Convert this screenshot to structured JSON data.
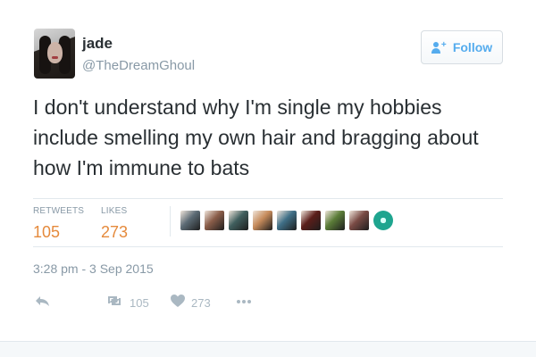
{
  "author": {
    "name": "jade",
    "handle": "@TheDreamGhoul"
  },
  "follow_button": {
    "label": "Follow"
  },
  "tweet": {
    "text": "I don't understand why I'm single my hobbies include smelling my own hair and bragging about how I'm immune to bats"
  },
  "stats": {
    "retweets_label": "RETWEETS",
    "retweets_count": "105",
    "likes_label": "LIKES",
    "likes_count": "273"
  },
  "liker_avatars": [
    {
      "name": "liker-avatar-1",
      "icon": "avatar",
      "color": "#5c6b75"
    },
    {
      "name": "liker-avatar-2",
      "icon": "avatar",
      "color": "#8a5d49"
    },
    {
      "name": "liker-avatar-3",
      "icon": "avatar",
      "color": "#405f5e"
    },
    {
      "name": "liker-avatar-4",
      "icon": "avatar",
      "color": "#c68b5b"
    },
    {
      "name": "liker-avatar-5",
      "icon": "avatar",
      "color": "#3f6f87"
    },
    {
      "name": "liker-avatar-6",
      "icon": "avatar",
      "color": "#5b1e1a"
    },
    {
      "name": "liker-avatar-7",
      "icon": "avatar",
      "color": "#5b7c38"
    },
    {
      "name": "liker-avatar-8",
      "icon": "avatar",
      "color": "#7a4b45"
    },
    {
      "name": "liker-avatar-9",
      "icon": "avatar",
      "color": "#1ea58f"
    }
  ],
  "timestamp": "3:28 pm - 3 Sep 2015",
  "actions": {
    "reply_icon": "reply-icon",
    "retweet_icon": "retweet-icon",
    "retweet_count": "105",
    "like_icon": "heart-icon",
    "like_count": "273",
    "more_icon": "more-icon"
  },
  "colors": {
    "accent": "#55acee",
    "stat_values": "#e58a3c",
    "muted_text": "#8899a6",
    "main_text": "#292f33",
    "divider": "#e1e8ed"
  }
}
